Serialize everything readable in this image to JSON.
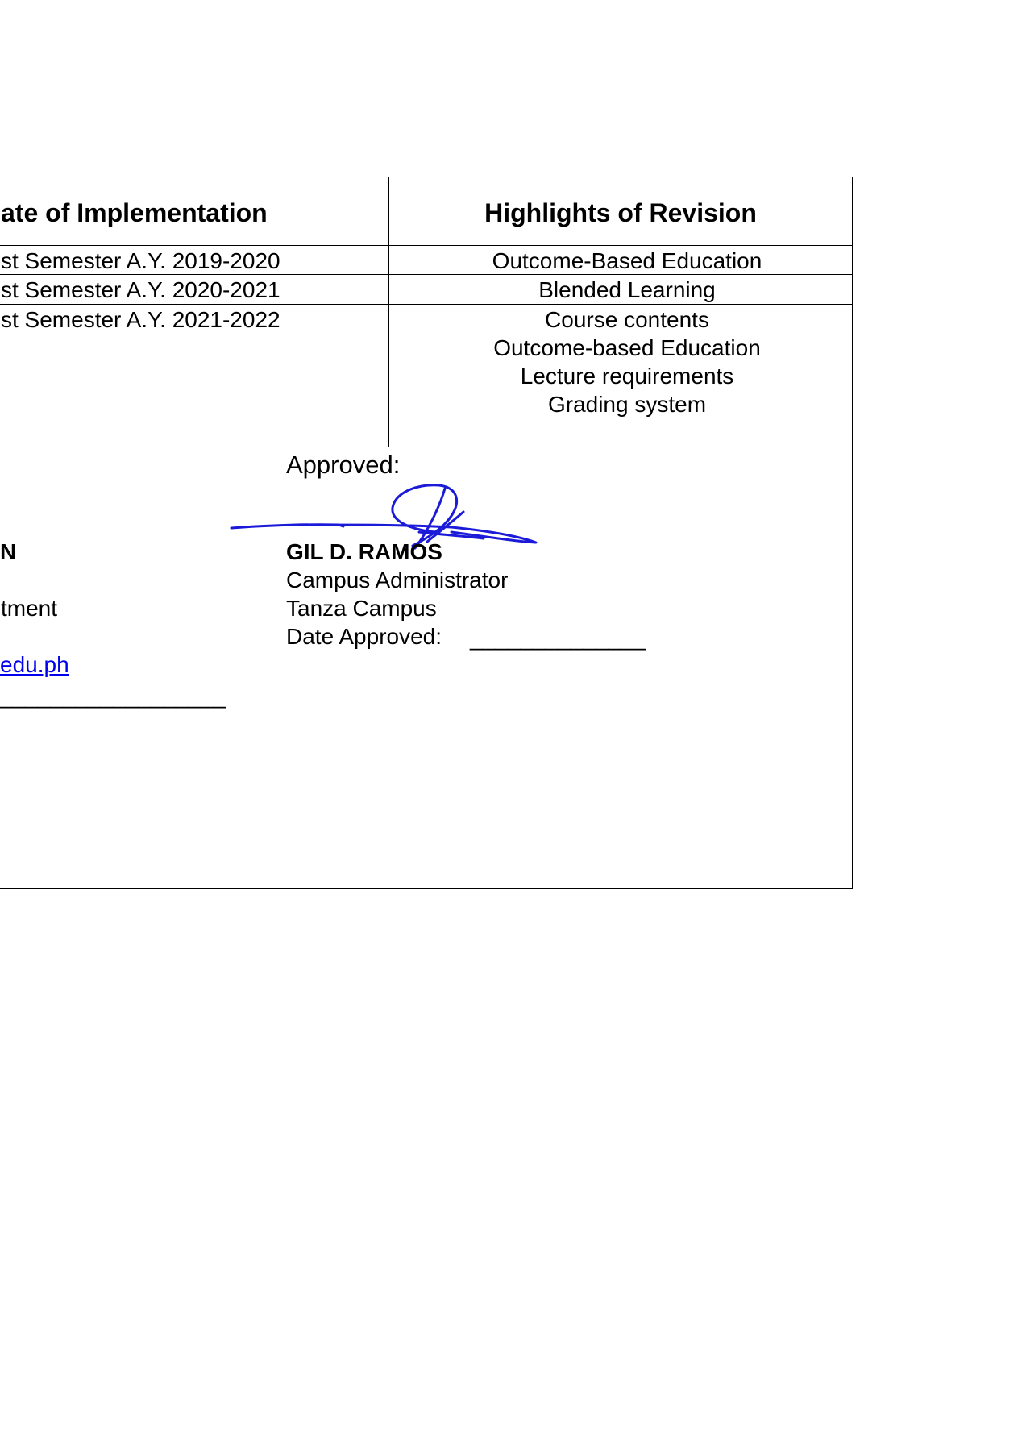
{
  "revision_table": {
    "headers": {
      "date_of_implementation": "ate of Implementation",
      "highlights_of_revision": "Highlights of Revision"
    },
    "rows": [
      {
        "date": "st Semester A.Y. 2019-2020",
        "highlights": [
          "Outcome-Based Education"
        ]
      },
      {
        "date": "st Semester A.Y. 2020-2021",
        "highlights": [
          "Blended Learning"
        ]
      },
      {
        "date": "st Semester A.Y. 2021-2022",
        "highlights": [
          "Course contents",
          "Outcome-based Education",
          "Lecture requirements",
          "Grading system"
        ]
      }
    ]
  },
  "left_block": {
    "name_fragment": "N",
    "title_fragment": "tment",
    "email_fragment": "edu.ph",
    "blank_line": "__________________"
  },
  "approval": {
    "label": "Approved:",
    "signature_owner": "GIL D. RAMOS",
    "name": "GIL D. RAMOS",
    "position": "Campus Administrator",
    "campus": "Tanza Campus",
    "date_label": "Date Approved:",
    "date_blank": "______________"
  },
  "colors": {
    "ink": "#000000",
    "link": "#0000ee",
    "signature": "#1a1ad8"
  }
}
